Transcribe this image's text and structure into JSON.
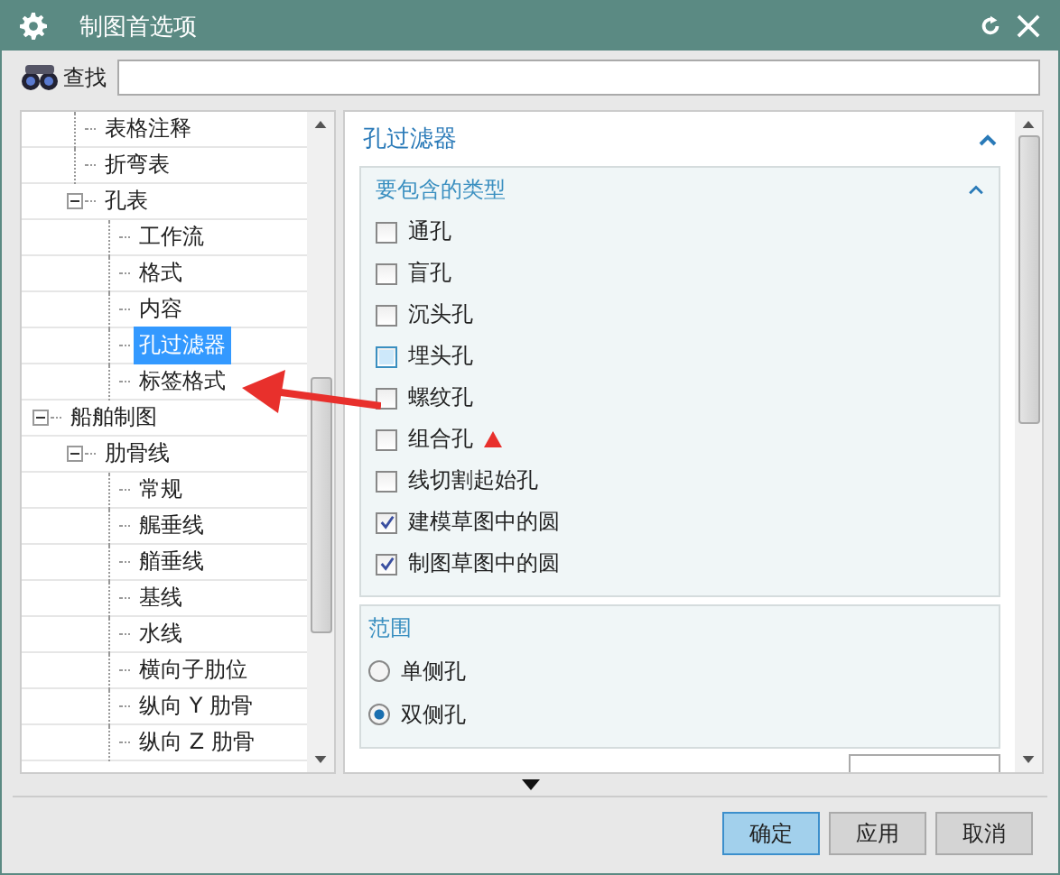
{
  "window": {
    "title": "制图首选项"
  },
  "search": {
    "label": "查找"
  },
  "tree": {
    "continued_items": [
      {
        "label": "表格注释",
        "selected": false
      },
      {
        "label": "折弯表",
        "selected": false
      },
      {
        "label": "孔表",
        "selected": false,
        "expanded": true,
        "children": [
          {
            "label": "工作流",
            "selected": false
          },
          {
            "label": "格式",
            "selected": false
          },
          {
            "label": "内容",
            "selected": false
          },
          {
            "label": "孔过滤器",
            "selected": true
          },
          {
            "label": "标签格式",
            "selected": false
          }
        ]
      }
    ],
    "items": [
      {
        "label": "船舶制图",
        "selected": false,
        "expanded": true,
        "children": [
          {
            "label": "肋骨线",
            "selected": false,
            "expanded": true,
            "children": [
              {
                "label": "常规",
                "selected": false
              },
              {
                "label": "艉垂线",
                "selected": false
              },
              {
                "label": "艏垂线",
                "selected": false
              },
              {
                "label": "基线",
                "selected": false
              },
              {
                "label": "水线",
                "selected": false
              },
              {
                "label": "横向子肋位",
                "selected": false
              },
              {
                "label": "纵向 Y 肋骨",
                "selected": false
              },
              {
                "label": "纵向 Z 肋骨",
                "selected": false
              }
            ]
          }
        ]
      }
    ]
  },
  "panel": {
    "title": "孔过滤器",
    "expanded": true,
    "types_group": {
      "title": "要包含的类型",
      "expanded": true,
      "options": [
        {
          "label": "通孔",
          "checked": false,
          "hover": false
        },
        {
          "label": "盲孔",
          "checked": false,
          "hover": false
        },
        {
          "label": "沉头孔",
          "checked": false,
          "hover": false
        },
        {
          "label": "埋头孔",
          "checked": false,
          "hover": true
        },
        {
          "label": "螺纹孔",
          "checked": false,
          "hover": false
        },
        {
          "label": "组合孔",
          "checked": false,
          "hover": false
        },
        {
          "label": "线切割起始孔",
          "checked": false,
          "hover": false
        },
        {
          "label": "建模草图中的圆",
          "checked": true,
          "hover": false
        },
        {
          "label": "制图草图中的圆",
          "checked": true,
          "hover": false
        }
      ]
    },
    "range_group": {
      "title": "范围",
      "options": [
        {
          "label": "单侧孔",
          "selected": false
        },
        {
          "label": "双侧孔",
          "selected": true
        }
      ]
    }
  },
  "buttons": [
    {
      "label": "确定",
      "kind": "primary"
    },
    {
      "label": "应用",
      "kind": "normal"
    },
    {
      "label": "取消",
      "kind": "normal"
    }
  ]
}
